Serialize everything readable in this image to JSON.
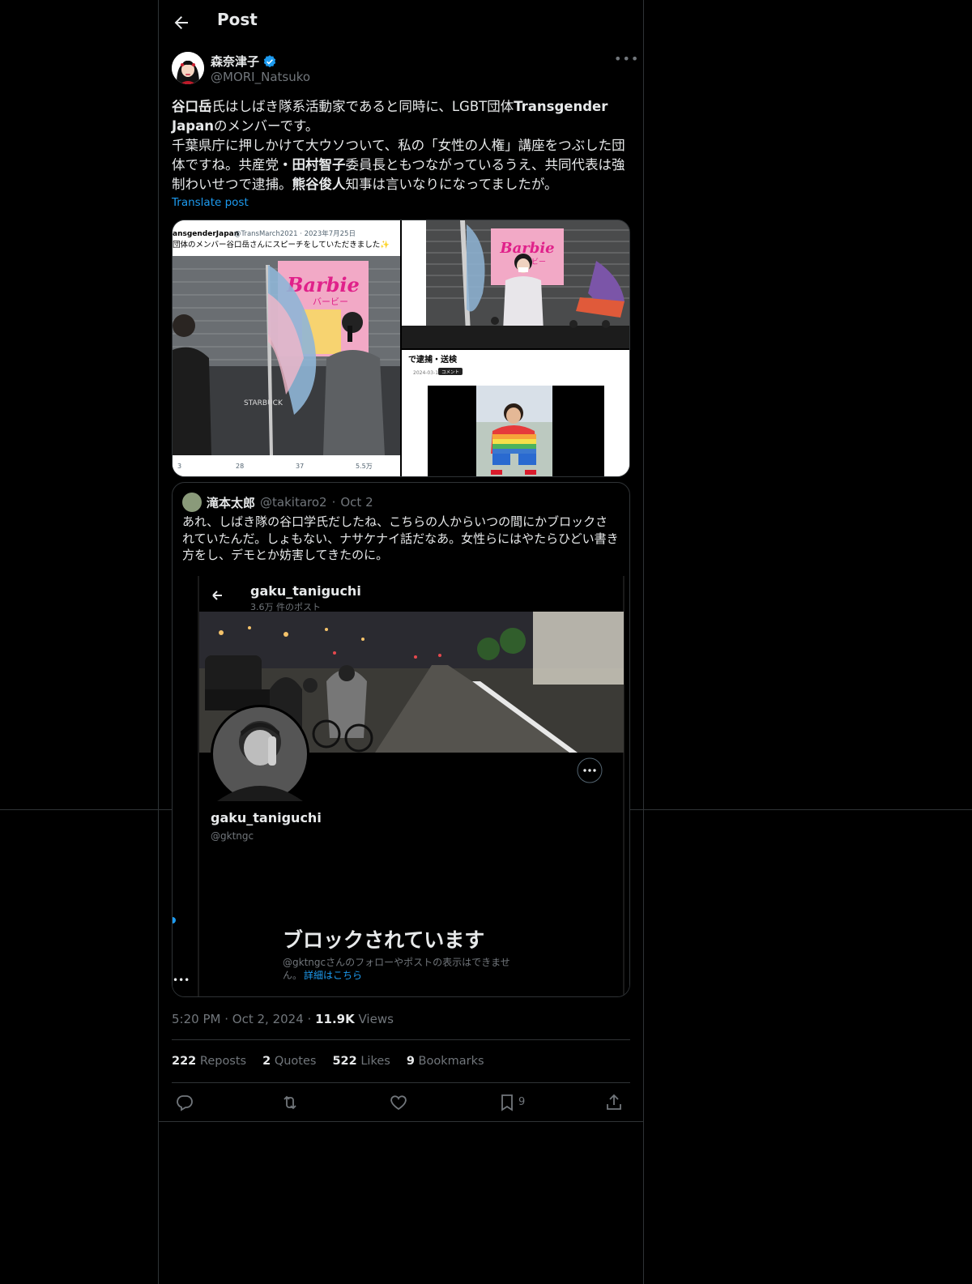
{
  "header": {
    "title": "Post"
  },
  "author": {
    "name": "森奈津子",
    "handle": "@MORI_Natsuko",
    "verified": true
  },
  "post": {
    "parts": [
      {
        "b": true,
        "t": "谷口岳"
      },
      {
        "b": false,
        "t": "氏はしばき隊系活動家であると同時に、LGBT団体"
      },
      {
        "b": true,
        "t": "Transgender Japan"
      },
      {
        "b": false,
        "t": "のメンバーです。\n千葉県庁に押しかけて大ウソついて、私の「女性の人権」講座をつぶした団体ですね。共産党"
      },
      {
        "b": true,
        "t": "・田村智子"
      },
      {
        "b": false,
        "t": "委員長ともつながっているうえ、共同代表は強制わいせつで逮捕。"
      },
      {
        "b": true,
        "t": "熊谷俊人"
      },
      {
        "b": false,
        "t": "知事は言いなりになってましたが。"
      }
    ],
    "translate_label": "Translate post"
  },
  "media": {
    "left": {
      "account": "ansgenderJapan",
      "handle_date": "@TransMarch2021 · 2023年7月25日",
      "text": "団体のメンバー谷口岳さんにスピーチをしていただきました✨",
      "banner": "Barbie",
      "banner_sub": "バービー",
      "store": "STARBUCK",
      "stats": [
        "3",
        "28",
        "37",
        "5.5万"
      ]
    },
    "top_right": {
      "banner": "Barbie",
      "banner_sub": "バービー"
    },
    "bottom_right": {
      "headline": "で逮捕・送検",
      "date": "2024-03-19",
      "tag": "コメント"
    }
  },
  "quote": {
    "name": "滝本太郎",
    "handle": "@takitaro2",
    "date": "Oct 2",
    "text": "あれ、しばき隊の谷口学氏だしたね、こちらの人からいつの間にかブロックされていたんだ。しょもない、ナサケナイ話だなあ。女性らにはやたらひどい書き方をし、デモとか妨害してきたのに。",
    "shot": {
      "title": "gaku_taniguchi",
      "posts": "3.6万 件のポスト",
      "name": "gaku_taniguchi",
      "handle": "@gktngc",
      "blocked_title": "ブロックされています",
      "blocked_desc_1": "@gktngcさんのフォローやポストの表示はできませ",
      "blocked_desc_2": "ん。",
      "blocked_link": "詳細はこちら"
    }
  },
  "meta": {
    "time": "5:20 PM",
    "date": "Oct 2, 2024",
    "views": "11.9K",
    "views_label": "Views"
  },
  "stats": [
    {
      "count": "222",
      "label": "Reposts"
    },
    {
      "count": "2",
      "label": "Quotes"
    },
    {
      "count": "522",
      "label": "Likes"
    },
    {
      "count": "9",
      "label": "Bookmarks"
    }
  ],
  "actions": {
    "bookmark_count": "9"
  },
  "colors": {
    "accent": "#1d9bf0",
    "muted": "#71767b",
    "border": "#2f3336"
  }
}
